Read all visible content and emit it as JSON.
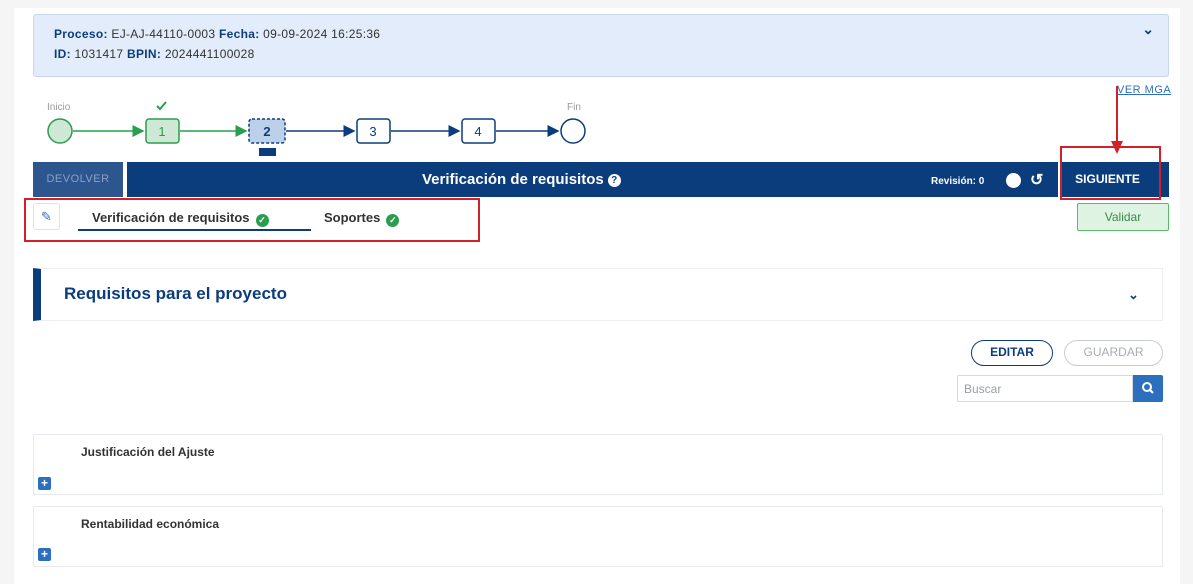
{
  "info": {
    "proceso_label": "Proceso:",
    "proceso_value": "EJ-AJ-44110-0003",
    "fecha_label": "Fecha:",
    "fecha_value": "09-09-2024 16:25:36",
    "id_label": "ID:",
    "id_value": "1031417",
    "bpin_label": "BPIN:",
    "bpin_value": "2024441100028"
  },
  "flow": {
    "start_label": "Inicio",
    "end_label": "Fin",
    "steps": [
      "1",
      "2",
      "3",
      "4"
    ],
    "completed_steps": 1,
    "current_step": "2",
    "ver_mga": "VER MGA"
  },
  "header": {
    "devolver": "DEVOLVER",
    "title": "Verificación de requisitos",
    "revision": "Revisión: 0",
    "siguiente": "SIGUIENTE"
  },
  "tabs": [
    {
      "label": "Verificación de requisitos",
      "checked": true,
      "active": true
    },
    {
      "label": "Soportes",
      "checked": true,
      "active": false
    }
  ],
  "validar": "Validar",
  "section": {
    "title": "Requisitos para el proyecto"
  },
  "actions": {
    "editar": "EDITAR",
    "guardar": "GUARDAR",
    "search_placeholder": "Buscar"
  },
  "cards": [
    {
      "title": "Justificación del Ajuste"
    },
    {
      "title": "Rentabilidad económica"
    }
  ],
  "colors": {
    "primary": "#0b3d7d",
    "accent": "#2d6fbf",
    "success": "#2a9d4f",
    "highlight": "#d0202a"
  }
}
